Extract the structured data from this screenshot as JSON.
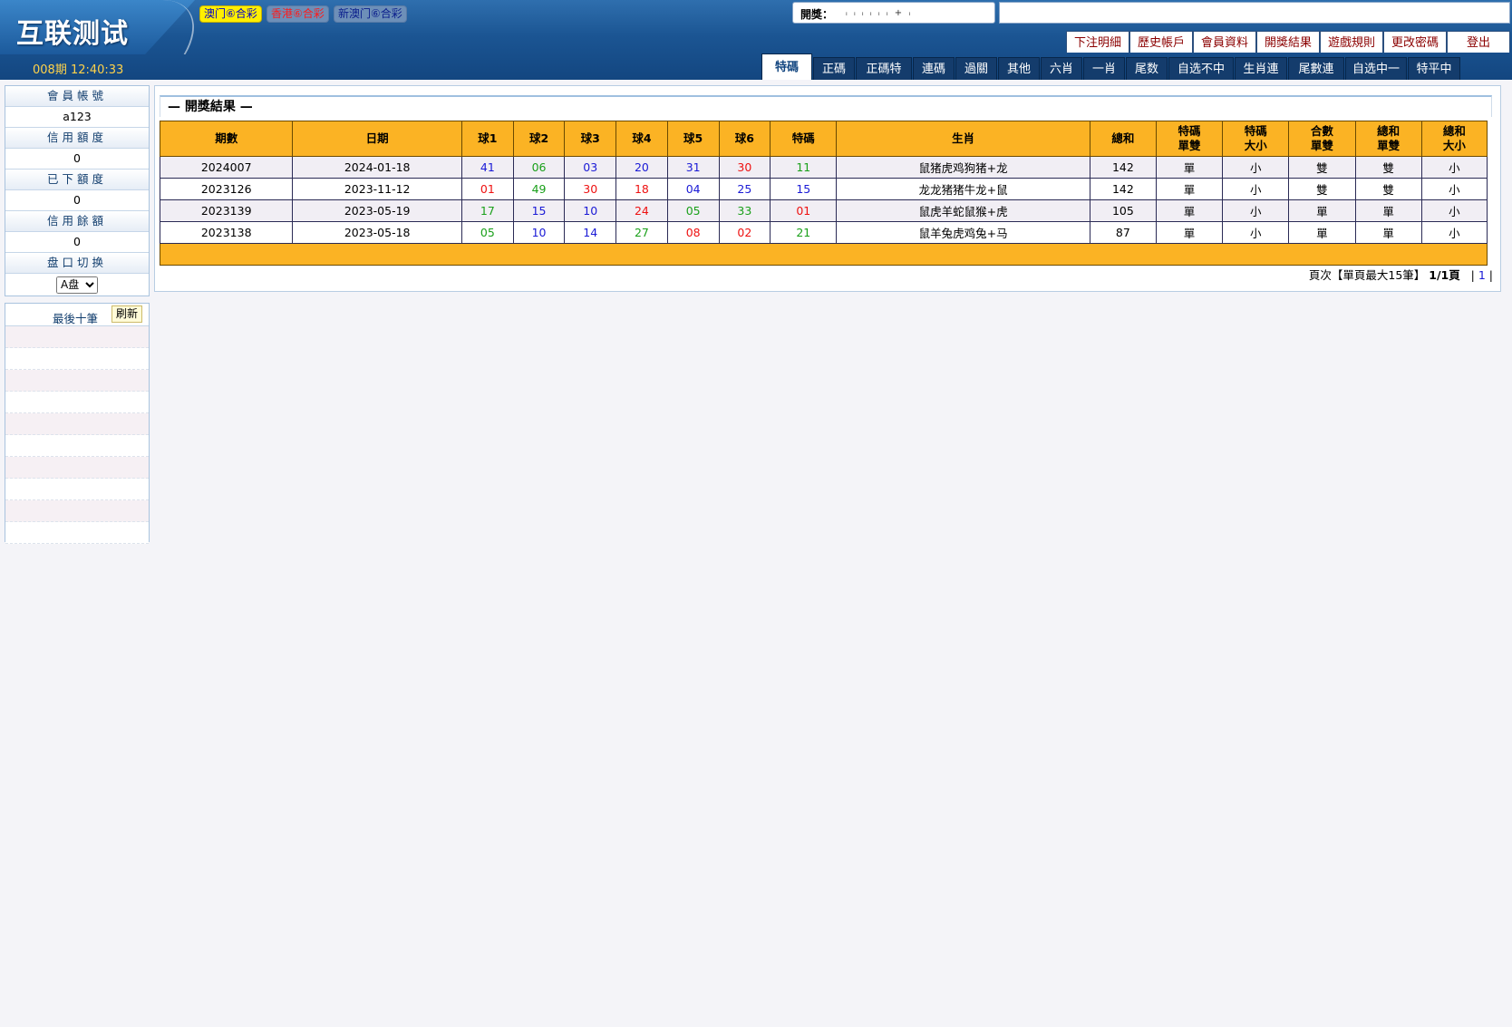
{
  "header": {
    "logo": "互联测试",
    "period_clock": "008期 12:40:33",
    "game_links": [
      {
        "label": "澳门⑥合彩",
        "style": "active"
      },
      {
        "label": "香港⑥合彩",
        "style": "hk"
      },
      {
        "label": "新澳门⑥合彩",
        "style": "newmo"
      }
    ],
    "draw_label": "開獎：",
    "draw_balls": "ᵢ ᵢ ᵢ ᵢ ᵢ ᵢ + ᵢ"
  },
  "top_menu": [
    "下注明細",
    "歷史帳戶",
    "會員資料",
    "開獎結果",
    "遊戲規則",
    "更改密碼",
    "登出"
  ],
  "tabs": [
    "特碼",
    "正碼",
    "正碼特",
    "連碼",
    "過關",
    "其他",
    "六肖",
    "一肖",
    "尾数",
    "自选不中",
    "生肖連",
    "尾數連",
    "自选中一",
    "特平中"
  ],
  "sidebar": {
    "account_label": "會員帳號",
    "account_value": "a123",
    "credit_label": "信用額度",
    "credit_value": "0",
    "used_label": "已下額度",
    "used_value": "0",
    "balance_label": "信用餘額",
    "balance_value": "0",
    "plate_label": "盘口切换",
    "plate_value": "A盘",
    "last_title": "最後十筆",
    "refresh_label": "刷新"
  },
  "main": {
    "section_title": "— 開獎結果 —",
    "columns": [
      "期數",
      "日期",
      "球1",
      "球2",
      "球3",
      "球4",
      "球5",
      "球6",
      "特碼",
      "生肖",
      "總和",
      "特碼\n單雙",
      "特碼\n大小",
      "合數\n單雙",
      "總和\n單雙",
      "總和\n大小"
    ],
    "rows": [
      {
        "issue": "2024007",
        "date": "2024-01-18",
        "balls": [
          "41",
          "06",
          "03",
          "20",
          "31",
          "30"
        ],
        "colors": [
          "blue",
          "green",
          "blue",
          "blue",
          "blue",
          "red"
        ],
        "special": "11",
        "special_color": "green",
        "zodiac": "鼠猪虎鸡狗猪+龙",
        "sum": "142",
        "sp_oe": "單",
        "sp_bs": "小",
        "comb_oe": "雙",
        "sum_oe": "雙",
        "sum_bs": "小"
      },
      {
        "issue": "2023126",
        "date": "2023-11-12",
        "balls": [
          "01",
          "49",
          "30",
          "18",
          "04",
          "25"
        ],
        "colors": [
          "red",
          "green",
          "red",
          "red",
          "blue",
          "blue"
        ],
        "special": "15",
        "special_color": "blue",
        "zodiac": "龙龙猪猪牛龙+鼠",
        "sum": "142",
        "sp_oe": "單",
        "sp_bs": "小",
        "comb_oe": "雙",
        "sum_oe": "雙",
        "sum_bs": "小"
      },
      {
        "issue": "2023139",
        "date": "2023-05-19",
        "balls": [
          "17",
          "15",
          "10",
          "24",
          "05",
          "33"
        ],
        "colors": [
          "green",
          "blue",
          "blue",
          "red",
          "green",
          "green"
        ],
        "special": "01",
        "special_color": "red",
        "zodiac": "鼠虎羊蛇鼠猴+虎",
        "sum": "105",
        "sp_oe": "單",
        "sp_bs": "小",
        "comb_oe": "單",
        "sum_oe": "單",
        "sum_bs": "小"
      },
      {
        "issue": "2023138",
        "date": "2023-05-18",
        "balls": [
          "05",
          "10",
          "14",
          "27",
          "08",
          "02"
        ],
        "colors": [
          "green",
          "blue",
          "blue",
          "green",
          "red",
          "red"
        ],
        "special": "21",
        "special_color": "green",
        "zodiac": "鼠羊兔虎鸡兔+马",
        "sum": "87",
        "sp_oe": "單",
        "sp_bs": "小",
        "comb_oe": "單",
        "sum_oe": "單",
        "sum_bs": "小"
      }
    ],
    "pager": {
      "prefix": "頁次【單頁最大15筆】",
      "page_info": "1/1頁",
      "sep_left": "|",
      "page_link": "1",
      "sep_right": "|"
    }
  },
  "colors": {
    "red": "#ee1111",
    "blue": "#1a1ad6",
    "green": "#1aa01a",
    "header_orange": "#fbb324",
    "header_blue": "#134680"
  }
}
